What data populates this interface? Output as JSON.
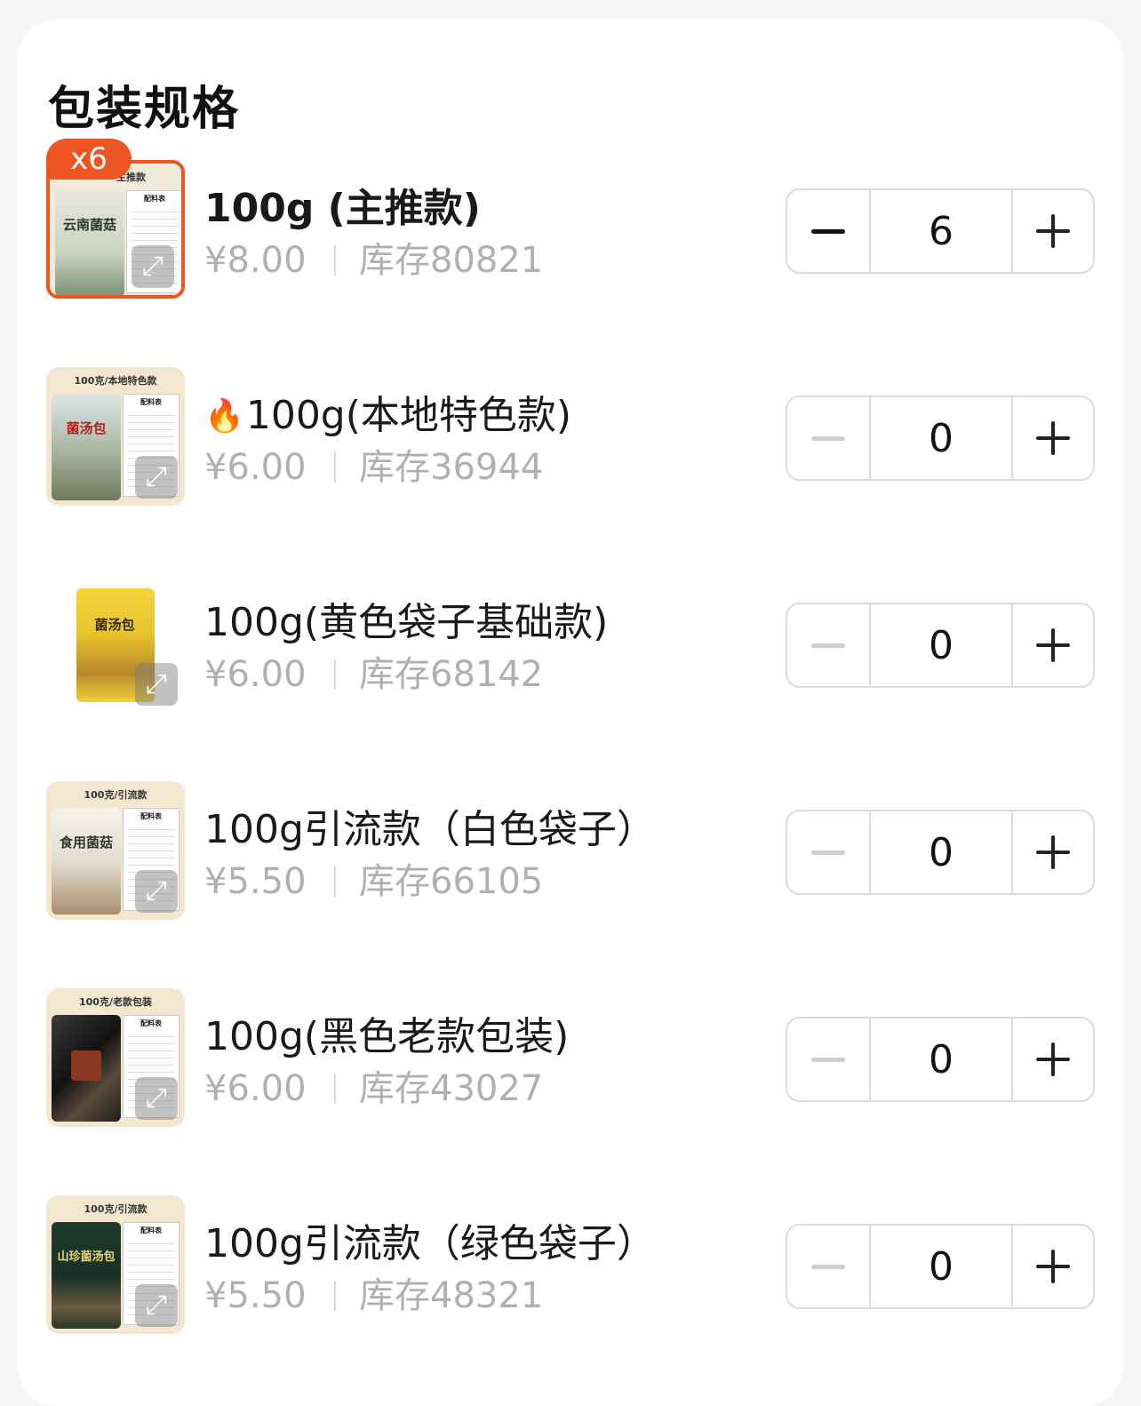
{
  "section": {
    "title": "包装规格"
  },
  "items": [
    {
      "name": "100g (主推款)",
      "price": "¥8.00",
      "stock": "库存80821",
      "quantity": "6",
      "badge": "x6",
      "thumb_banner": "主推款",
      "bag_text": "云南菌菇",
      "sheet_title": "配料表"
    },
    {
      "name": "100g(本地特色款)",
      "price": "¥6.00",
      "stock": "库存36944",
      "quantity": "0",
      "thumb_banner": "100克/本地特色款",
      "bag_text": "菌汤包",
      "sheet_title": "配料表"
    },
    {
      "name": "100g(黄色袋子基础款)",
      "price": "¥6.00",
      "stock": "库存68142",
      "quantity": "0",
      "bag_text": "菌汤包"
    },
    {
      "name": "100g引流款（白色袋子）",
      "price": "¥5.50",
      "stock": "库存66105",
      "quantity": "0",
      "thumb_banner": "100克/引流款",
      "bag_text": "食用菌菇",
      "sheet_title": "配料表"
    },
    {
      "name": "100g(黑色老款包装)",
      "price": "¥6.00",
      "stock": "库存43027",
      "quantity": "0",
      "thumb_banner": "100克/老款包装",
      "sheet_title": "配料表"
    },
    {
      "name": "100g引流款（绿色袋子）",
      "price": "¥5.50",
      "stock": "库存48321",
      "quantity": "0",
      "thumb_banner": "100克/引流款",
      "bag_text": "山珍菌汤包",
      "sheet_title": "配料表"
    }
  ],
  "icons": {
    "minus": "minus-icon",
    "plus": "plus-icon",
    "expand": "expand-icon",
    "fire": "fire-icon"
  },
  "colors": {
    "accent": "#ee5522",
    "muted_text": "#b0b0b0",
    "border": "#dcdcdc"
  }
}
